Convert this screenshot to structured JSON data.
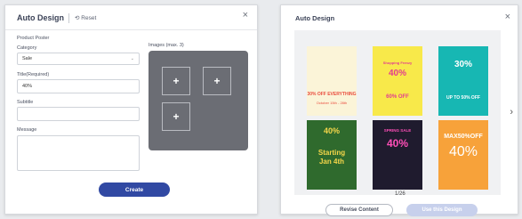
{
  "left_panel": {
    "title": "Auto Design",
    "reset_label": "Reset",
    "close_glyph": "×",
    "section_label": "Product Poster",
    "category": {
      "label": "Category",
      "value": "Sale"
    },
    "title_field": {
      "label": "Title(Required)",
      "value": "40%"
    },
    "subtitle_field": {
      "label": "Subtitle",
      "value": ""
    },
    "message_field": {
      "label": "Message",
      "value": ""
    },
    "images": {
      "label": "Images (max. 3)",
      "add_glyph": "+"
    },
    "create_label": "Create"
  },
  "right_panel": {
    "title": "Auto Design",
    "close_glyph": "×",
    "next_glyph": "›",
    "pager": "1/26",
    "revise_label": "Revise Content",
    "use_label": "Use this Design",
    "cards": [
      {
        "lines": [
          "30% OFF EVERYTHING"
        ],
        "small": "October 15th - 28th",
        "bg": "#fbf4d8",
        "accent": "#e94d3f"
      },
      {
        "lines": [
          "40%",
          "60% OFF"
        ],
        "small": "Shopping Frenzy",
        "bg": "#f8e94a",
        "accent": "#e23d8f"
      },
      {
        "lines": [
          "30%",
          "UP TO 50% OFF"
        ],
        "small": "",
        "bg": "#17b7b3",
        "accent": "#ffffff"
      },
      {
        "lines": [
          "40%",
          "Starting",
          "Jan 4th"
        ],
        "small": "",
        "bg": "#2f6a2d",
        "accent": "#f5d64a"
      },
      {
        "lines": [
          "SPRING SALE",
          "40%"
        ],
        "small": "",
        "bg": "#1f1b2e",
        "accent": "#ff4fb8"
      },
      {
        "lines": [
          "MAX50%OFF",
          "40%"
        ],
        "small": "",
        "bg": "#f7a23a",
        "accent": "#ffffff"
      }
    ]
  }
}
